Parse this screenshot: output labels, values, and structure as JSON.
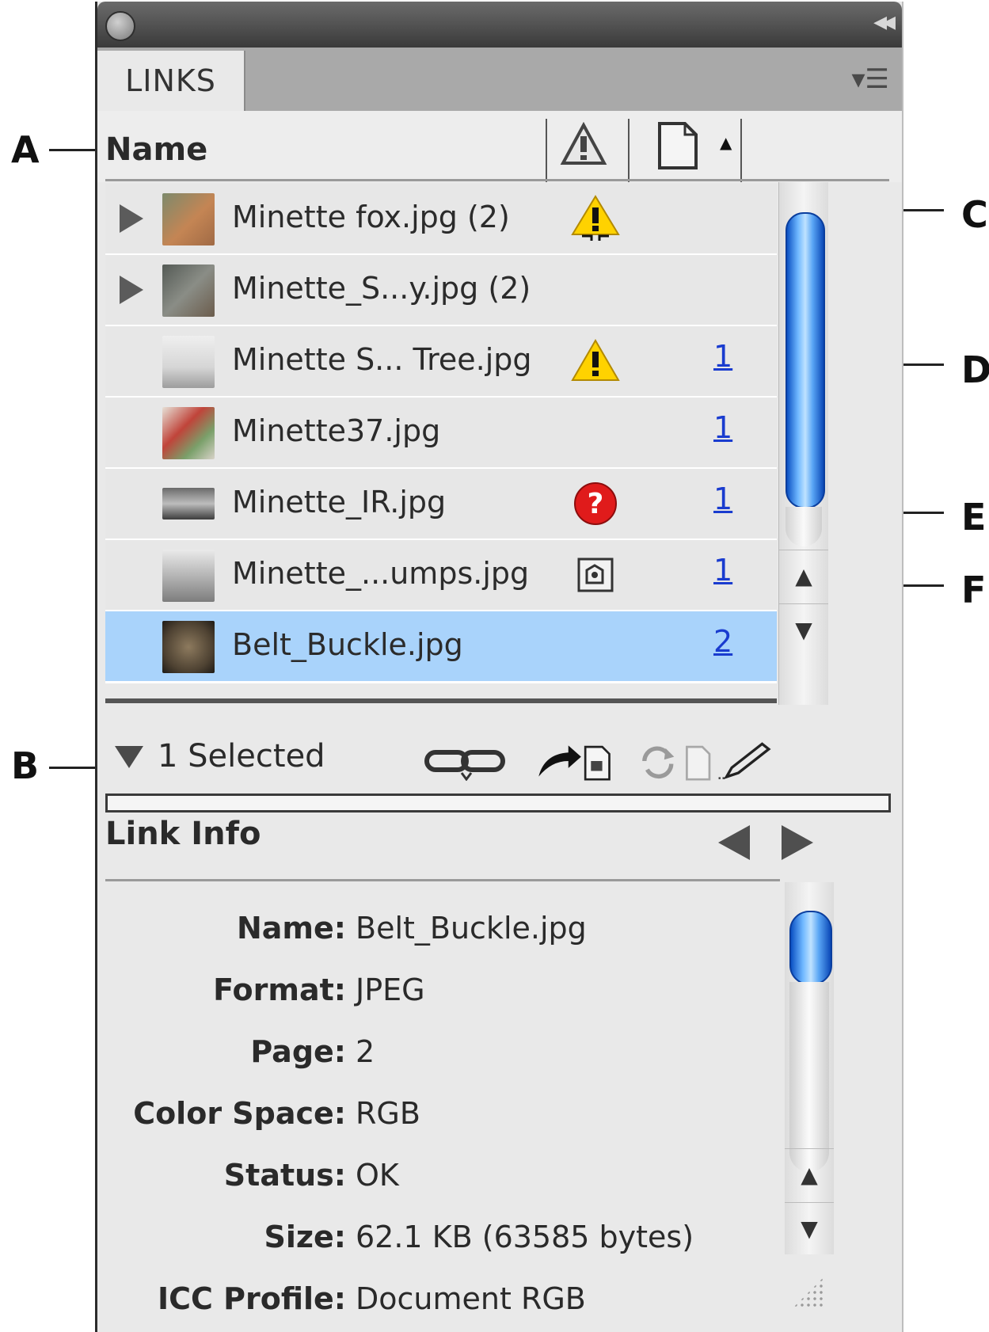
{
  "panel": {
    "tab_label": "LINKS",
    "column_name": "Name"
  },
  "links": [
    {
      "name": "Minette fox.jpg (2)",
      "status": "warning-modified",
      "page": "",
      "expander": true,
      "thumb": "#b07c58"
    },
    {
      "name": "Minette_S...y.jpg (2)",
      "status": "",
      "page": "",
      "expander": true,
      "thumb": "#6e6a63"
    },
    {
      "name": "Minette S... Tree.jpg",
      "status": "warning",
      "page": "1",
      "expander": false,
      "thumb": "#cfcfcf"
    },
    {
      "name": "Minette37.jpg",
      "status": "",
      "page": "1",
      "expander": false,
      "thumb": "#c96a5a"
    },
    {
      "name": "Minette_IR.jpg",
      "status": "missing",
      "page": "1",
      "expander": false,
      "thumb": "#555555"
    },
    {
      "name": "Minette_...umps.jpg",
      "status": "embedded",
      "page": "1",
      "expander": false,
      "thumb": "#bdbdbd"
    },
    {
      "name": "Belt_Buckle.jpg",
      "status": "",
      "page": "2",
      "expander": false,
      "thumb": "#6b5a45",
      "selected": true
    }
  ],
  "selection": {
    "label": "1 Selected"
  },
  "link_info": {
    "title": "Link Info",
    "fields": [
      {
        "label": "Name:",
        "value": "Belt_Buckle.jpg"
      },
      {
        "label": "Format:",
        "value": "JPEG"
      },
      {
        "label": "Page:",
        "value": "2"
      },
      {
        "label": "Color Space:",
        "value": "RGB"
      },
      {
        "label": "Status:",
        "value": "OK"
      },
      {
        "label": "Size:",
        "value": "62.1 KB (63585 bytes)"
      },
      {
        "label": "ICC Profile:",
        "value": "Document RGB"
      }
    ]
  },
  "callouts": {
    "a": "A",
    "b": "B",
    "c": "C",
    "d": "D",
    "e": "E",
    "f": "F"
  }
}
